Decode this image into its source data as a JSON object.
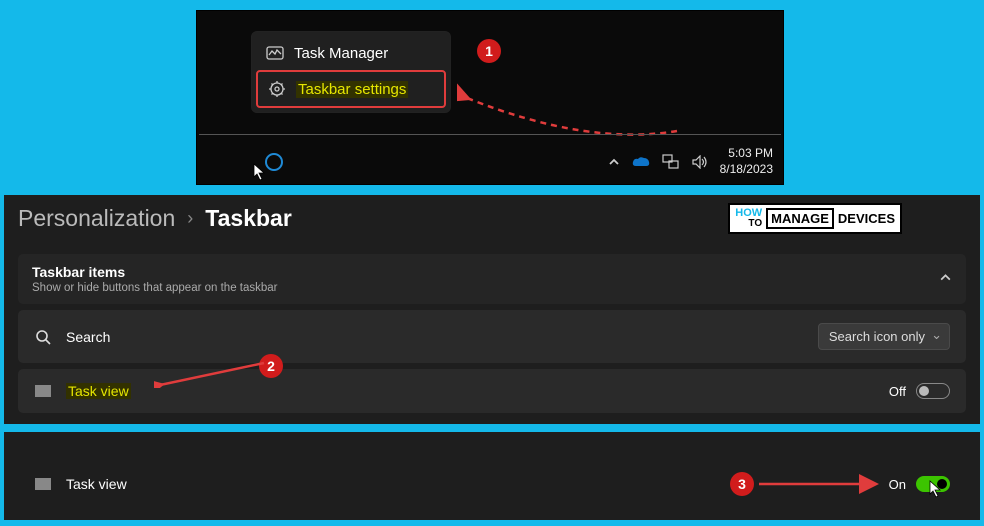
{
  "context_menu": {
    "task_manager": "Task Manager",
    "taskbar_settings": "Taskbar settings"
  },
  "badges": {
    "one": "1",
    "two": "2",
    "three": "3"
  },
  "datetime": {
    "time": "5:03 PM",
    "date": "8/18/2023"
  },
  "breadcrumb": {
    "parent": "Personalization",
    "current": "Taskbar"
  },
  "watermark": {
    "how": "HOW",
    "to": "TO",
    "manage": "MANAGE",
    "devices": "DEVICES"
  },
  "section": {
    "title": "Taskbar items",
    "subtitle": "Show or hide buttons that appear on the taskbar"
  },
  "rows": {
    "search": {
      "label": "Search",
      "dropdown": "Search icon only"
    },
    "taskview_off": {
      "label": "Task view",
      "state": "Off"
    },
    "taskview_on": {
      "label": "Task view",
      "state": "On"
    }
  }
}
